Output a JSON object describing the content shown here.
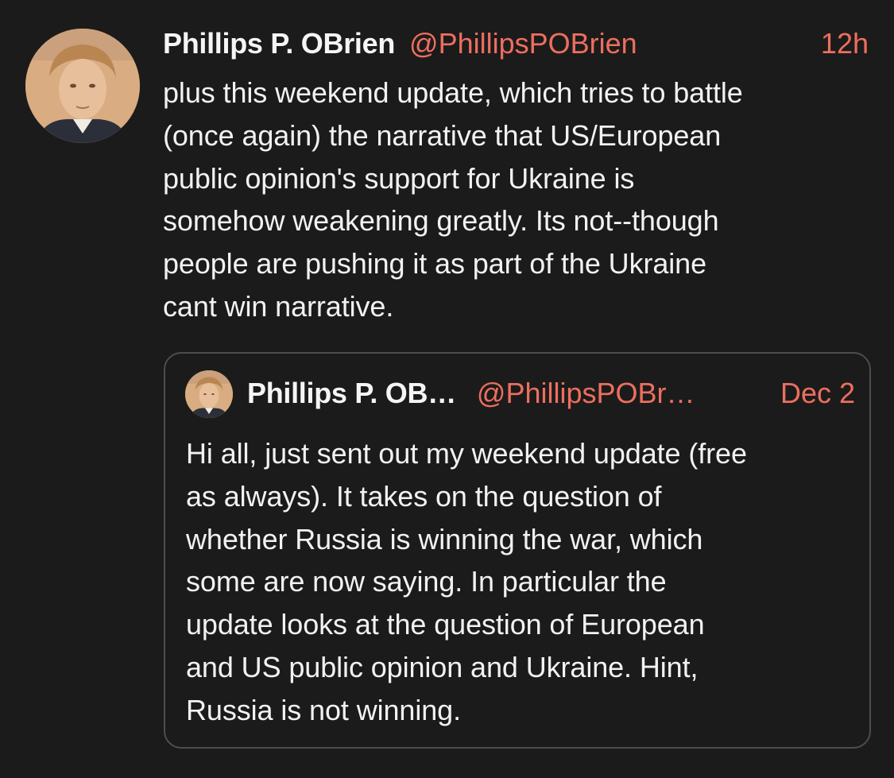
{
  "tweet": {
    "author_name": "Phillips P. OBrien",
    "handle": "@PhillipsPOBrien",
    "time": "12h",
    "text": "plus this weekend update, which tries to battle\n(once again) the narrative that US/European\npublic opinion's support for Ukraine is\nsomehow weakening greatly. Its not--though\npeople are pushing it as part of the Ukraine\ncant win narrative."
  },
  "quoted_tweet": {
    "author_name": "Phillips P. OB…",
    "handle": "@PhillipsPOBr…",
    "date": "Dec 2",
    "text": "Hi all, just sent out my weekend update (free\nas always). It takes on the question of\nwhether Russia is winning the war, which\nsome are now saying. In particular the\nupdate looks at the question of European\nand US public opinion and Ukraine. Hint,\nRussia is not winning."
  },
  "colors": {
    "background": "#1c1b1b",
    "accent": "#ec6f5f",
    "text": "#f2f2f2",
    "card_border": "#4d4d4d"
  }
}
